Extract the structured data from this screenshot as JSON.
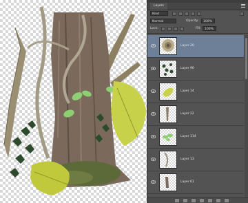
{
  "panel": {
    "tab_label": "Layers",
    "kind_label": "Kind",
    "blend_mode": "Normal",
    "opacity_label": "Opacity:",
    "opacity_value": "100%",
    "lock_label": "Lock:",
    "fill_label": "Fill:",
    "fill_value": "100%"
  },
  "layers": [
    {
      "name": "Layer 20",
      "selected": true
    },
    {
      "name": "Layer 90",
      "selected": false
    },
    {
      "name": "Layer 14",
      "selected": false
    },
    {
      "name": "Layer 22",
      "selected": false
    },
    {
      "name": "Layer 114",
      "selected": false
    },
    {
      "name": "Layer 13",
      "selected": false
    },
    {
      "name": "Layer 61",
      "selected": false
    }
  ],
  "colors": {
    "panel_bg": "#535353",
    "selected_row": "#6e7f98",
    "leaf_green": "#c8d14a"
  },
  "icons": [
    "eye-icon",
    "link-icon",
    "fx-icon",
    "mask-icon",
    "adjustment-icon",
    "folder-icon",
    "new-layer-icon",
    "trash-icon"
  ]
}
